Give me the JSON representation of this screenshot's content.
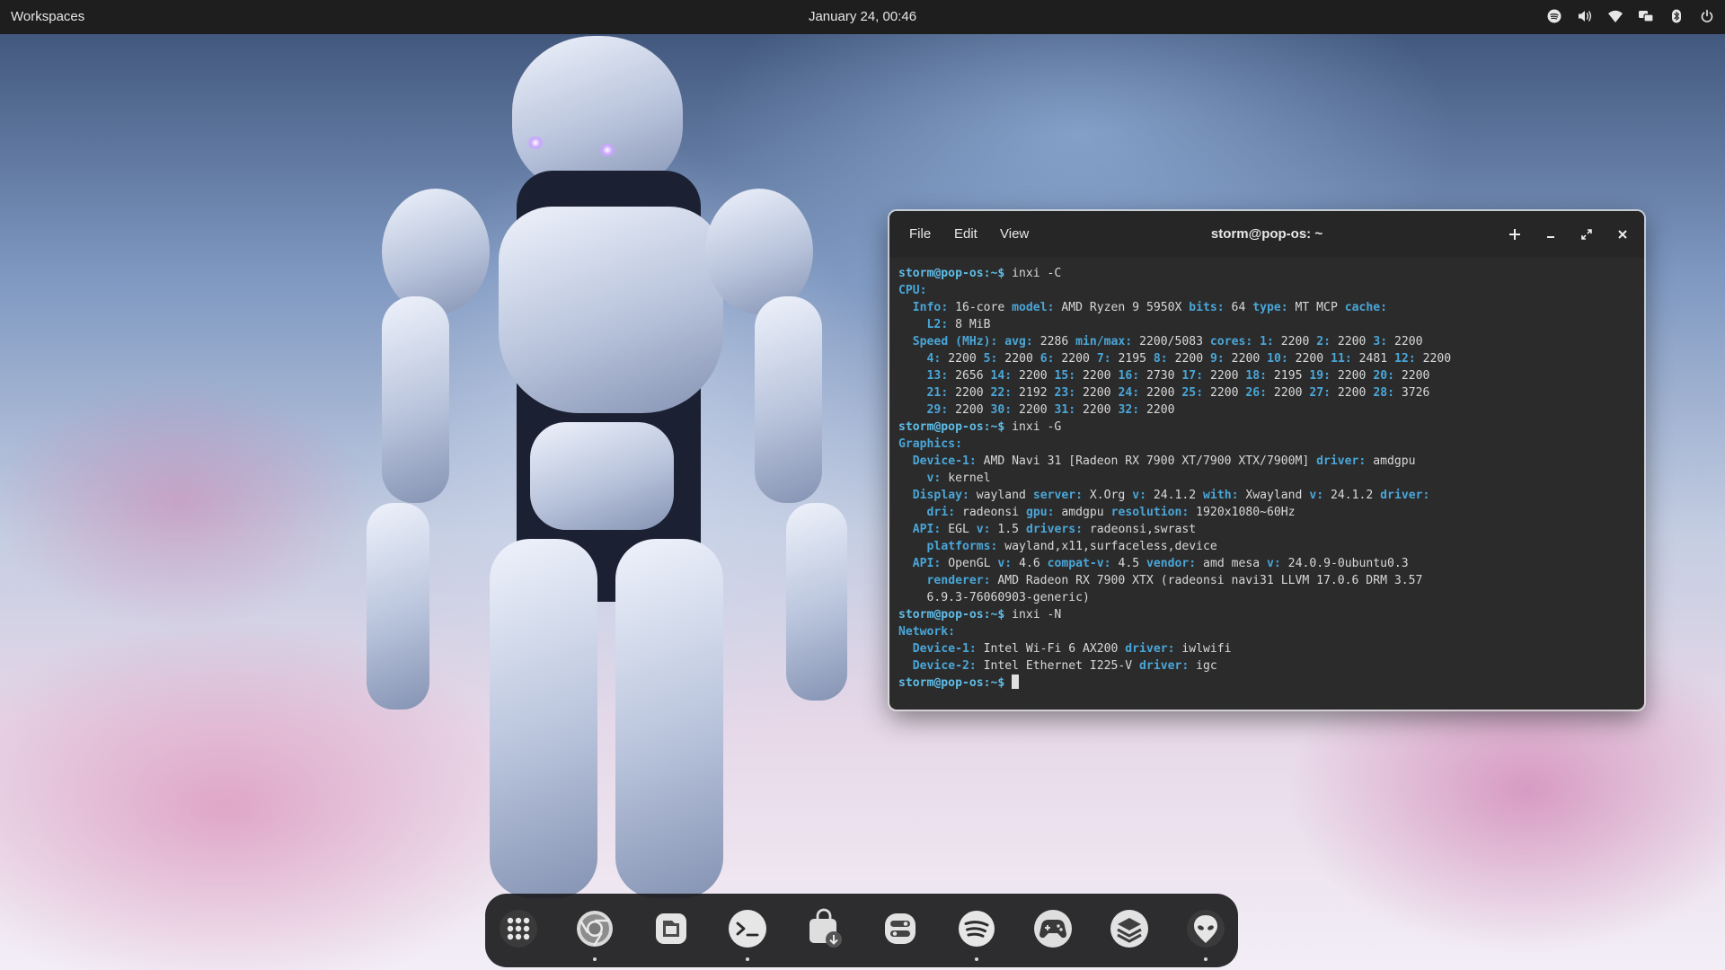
{
  "topbar": {
    "workspaces_label": "Workspaces",
    "clock": "January 24, 00:46",
    "tray_icons": [
      "spotify-icon",
      "volume-icon",
      "wifi-icon",
      "display-icon",
      "bluetooth-icon",
      "power-icon"
    ]
  },
  "terminal": {
    "title": "storm@pop-os: ~",
    "menu": [
      "File",
      "Edit",
      "View"
    ],
    "buttons": [
      "new-tab",
      "minimize",
      "maximize",
      "close"
    ],
    "prompt": "storm@pop-os:~$",
    "lines": [
      {
        "type": "prompt",
        "cmd": "inxi -C"
      },
      {
        "type": "plain",
        "segments": [
          [
            "k",
            "CPU:"
          ]
        ]
      },
      {
        "type": "plain",
        "segments": [
          [
            "",
            "  "
          ],
          [
            "k",
            "Info:"
          ],
          [
            "",
            " 16-core "
          ],
          [
            "k",
            "model:"
          ],
          [
            "",
            " AMD Ryzen 9 5950X "
          ],
          [
            "k",
            "bits:"
          ],
          [
            "",
            " 64 "
          ],
          [
            "k",
            "type:"
          ],
          [
            "",
            " MT MCP "
          ],
          [
            "k",
            "cache:"
          ]
        ]
      },
      {
        "type": "plain",
        "segments": [
          [
            "",
            "    "
          ],
          [
            "k",
            "L2:"
          ],
          [
            "",
            " 8 MiB"
          ]
        ]
      },
      {
        "type": "plain",
        "segments": [
          [
            "",
            "  "
          ],
          [
            "k",
            "Speed (MHz):"
          ],
          [
            "",
            ""
          ],
          [
            "k",
            " avg:"
          ],
          [
            "",
            " 2286 "
          ],
          [
            "k",
            "min/max:"
          ],
          [
            "",
            " 2200/5083 "
          ],
          [
            "k",
            "cores:"
          ],
          [
            "",
            " "
          ],
          [
            "k",
            "1:"
          ],
          [
            "",
            " 2200 "
          ],
          [
            "k",
            "2:"
          ],
          [
            "",
            " 2200 "
          ],
          [
            "k",
            "3:"
          ],
          [
            "",
            " 2200"
          ]
        ]
      },
      {
        "type": "plain",
        "segments": [
          [
            "",
            "    "
          ],
          [
            "k",
            "4:"
          ],
          [
            "",
            " 2200 "
          ],
          [
            "k",
            "5:"
          ],
          [
            "",
            " 2200 "
          ],
          [
            "k",
            "6:"
          ],
          [
            "",
            " 2200 "
          ],
          [
            "k",
            "7:"
          ],
          [
            "",
            " 2195 "
          ],
          [
            "k",
            "8:"
          ],
          [
            "",
            " 2200 "
          ],
          [
            "k",
            "9:"
          ],
          [
            "",
            " 2200 "
          ],
          [
            "k",
            "10:"
          ],
          [
            "",
            " 2200 "
          ],
          [
            "k",
            "11:"
          ],
          [
            "",
            " 2481 "
          ],
          [
            "k",
            "12:"
          ],
          [
            "",
            " 2200"
          ]
        ]
      },
      {
        "type": "plain",
        "segments": [
          [
            "",
            "    "
          ],
          [
            "k",
            "13:"
          ],
          [
            "",
            " 2656 "
          ],
          [
            "k",
            "14:"
          ],
          [
            "",
            " 2200 "
          ],
          [
            "k",
            "15:"
          ],
          [
            "",
            " 2200 "
          ],
          [
            "k",
            "16:"
          ],
          [
            "",
            " 2730 "
          ],
          [
            "k",
            "17:"
          ],
          [
            "",
            " 2200 "
          ],
          [
            "k",
            "18:"
          ],
          [
            "",
            " 2195 "
          ],
          [
            "k",
            "19:"
          ],
          [
            "",
            " 2200 "
          ],
          [
            "k",
            "20:"
          ],
          [
            "",
            " 2200"
          ]
        ]
      },
      {
        "type": "plain",
        "segments": [
          [
            "",
            "    "
          ],
          [
            "k",
            "21:"
          ],
          [
            "",
            " 2200 "
          ],
          [
            "k",
            "22:"
          ],
          [
            "",
            " 2192 "
          ],
          [
            "k",
            "23:"
          ],
          [
            "",
            " 2200 "
          ],
          [
            "k",
            "24:"
          ],
          [
            "",
            " 2200 "
          ],
          [
            "k",
            "25:"
          ],
          [
            "",
            " 2200 "
          ],
          [
            "k",
            "26:"
          ],
          [
            "",
            " 2200 "
          ],
          [
            "k",
            "27:"
          ],
          [
            "",
            " 2200 "
          ],
          [
            "k",
            "28:"
          ],
          [
            "",
            " 3726"
          ]
        ]
      },
      {
        "type": "plain",
        "segments": [
          [
            "",
            "    "
          ],
          [
            "k",
            "29:"
          ],
          [
            "",
            " 2200 "
          ],
          [
            "k",
            "30:"
          ],
          [
            "",
            " 2200 "
          ],
          [
            "k",
            "31:"
          ],
          [
            "",
            " 2200 "
          ],
          [
            "k",
            "32:"
          ],
          [
            "",
            " 2200"
          ]
        ]
      },
      {
        "type": "prompt",
        "cmd": "inxi -G"
      },
      {
        "type": "plain",
        "segments": [
          [
            "k",
            "Graphics:"
          ]
        ]
      },
      {
        "type": "plain",
        "segments": [
          [
            "",
            "  "
          ],
          [
            "k",
            "Device-1:"
          ],
          [
            "",
            " AMD Navi 31 [Radeon RX 7900 XT/7900 XTX/7900M] "
          ],
          [
            "k",
            "driver:"
          ],
          [
            "",
            " amdgpu"
          ]
        ]
      },
      {
        "type": "plain",
        "segments": [
          [
            "",
            "    "
          ],
          [
            "k",
            "v:"
          ],
          [
            "",
            " kernel"
          ]
        ]
      },
      {
        "type": "plain",
        "segments": [
          [
            "",
            "  "
          ],
          [
            "k",
            "Display:"
          ],
          [
            "",
            " wayland "
          ],
          [
            "k",
            "server:"
          ],
          [
            "",
            " X.Org "
          ],
          [
            "k",
            "v:"
          ],
          [
            "",
            " 24.1.2 "
          ],
          [
            "k",
            "with:"
          ],
          [
            "",
            " Xwayland "
          ],
          [
            "k",
            "v:"
          ],
          [
            "",
            " 24.1.2 "
          ],
          [
            "k",
            "driver:"
          ]
        ]
      },
      {
        "type": "plain",
        "segments": [
          [
            "",
            "    "
          ],
          [
            "k",
            "dri:"
          ],
          [
            "",
            " radeonsi "
          ],
          [
            "k",
            "gpu:"
          ],
          [
            "",
            " amdgpu "
          ],
          [
            "k",
            "resolution:"
          ],
          [
            "",
            " 1920x1080~60Hz"
          ]
        ]
      },
      {
        "type": "plain",
        "segments": [
          [
            "",
            "  "
          ],
          [
            "k",
            "API:"
          ],
          [
            "",
            " EGL "
          ],
          [
            "k",
            "v:"
          ],
          [
            "",
            " 1.5 "
          ],
          [
            "k",
            "drivers:"
          ],
          [
            "",
            " radeonsi,swrast"
          ]
        ]
      },
      {
        "type": "plain",
        "segments": [
          [
            "",
            "    "
          ],
          [
            "k",
            "platforms:"
          ],
          [
            "",
            " wayland,x11,surfaceless,device"
          ]
        ]
      },
      {
        "type": "plain",
        "segments": [
          [
            "",
            "  "
          ],
          [
            "k",
            "API:"
          ],
          [
            "",
            " OpenGL "
          ],
          [
            "k",
            "v:"
          ],
          [
            "",
            " 4.6 "
          ],
          [
            "k",
            "compat-v:"
          ],
          [
            "",
            " 4.5 "
          ],
          [
            "k",
            "vendor:"
          ],
          [
            "",
            " amd mesa "
          ],
          [
            "k",
            "v:"
          ],
          [
            "",
            " 24.0.9-0ubuntu0.3"
          ]
        ]
      },
      {
        "type": "plain",
        "segments": [
          [
            "",
            "    "
          ],
          [
            "k",
            "renderer:"
          ],
          [
            "",
            " AMD Radeon RX 7900 XTX (radeonsi navi31 LLVM 17.0.6 DRM 3.57"
          ]
        ]
      },
      {
        "type": "plain",
        "segments": [
          [
            "",
            "    6.9.3-76060903-generic)"
          ]
        ]
      },
      {
        "type": "prompt",
        "cmd": "inxi -N"
      },
      {
        "type": "plain",
        "segments": [
          [
            "k",
            "Network:"
          ]
        ]
      },
      {
        "type": "plain",
        "segments": [
          [
            "",
            "  "
          ],
          [
            "k",
            "Device-1:"
          ],
          [
            "",
            " Intel Wi-Fi 6 AX200 "
          ],
          [
            "k",
            "driver:"
          ],
          [
            "",
            " iwlwifi"
          ]
        ]
      },
      {
        "type": "plain",
        "segments": [
          [
            "",
            "  "
          ],
          [
            "k",
            "Device-2:"
          ],
          [
            "",
            " Intel Ethernet I225-V "
          ],
          [
            "k",
            "driver:"
          ],
          [
            "",
            " igc"
          ]
        ]
      },
      {
        "type": "prompt",
        "cmd": "",
        "cursor": true
      }
    ]
  },
  "dock": {
    "items": [
      {
        "name": "app-grid-icon",
        "running": false
      },
      {
        "name": "chrome-icon",
        "running": true
      },
      {
        "name": "files-icon",
        "running": false
      },
      {
        "name": "terminal-icon",
        "running": true
      },
      {
        "name": "software-store-icon",
        "running": false
      },
      {
        "name": "settings-toggle-icon",
        "running": false
      },
      {
        "name": "spotify-icon",
        "running": true
      },
      {
        "name": "gamepad-icon",
        "running": false
      },
      {
        "name": "stack-icon",
        "running": false
      },
      {
        "name": "alien-icon",
        "running": true
      }
    ]
  },
  "colors": {
    "terminal_bg": "#2b2b2b",
    "keyword": "#4aa6d8",
    "prompt": "#5fbde8",
    "topbar_bg": "#1e1e1e",
    "dock_bg": "#1c1c1e"
  }
}
